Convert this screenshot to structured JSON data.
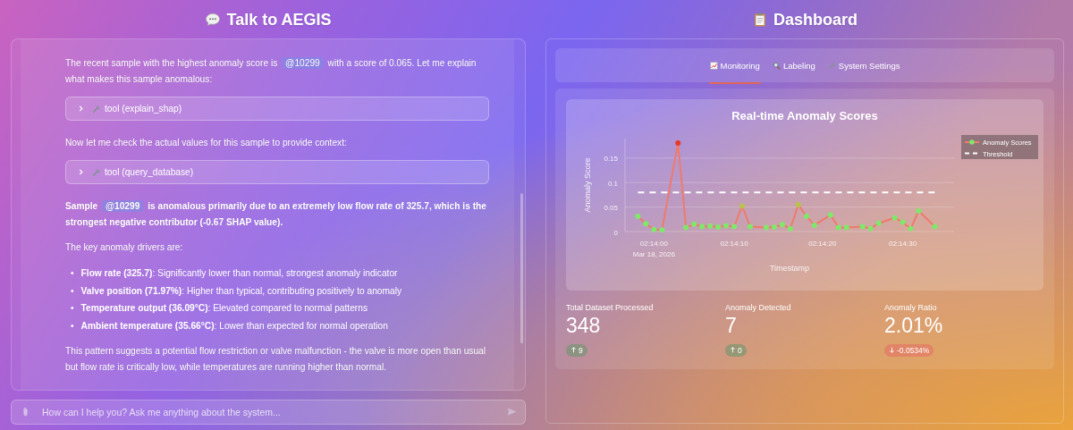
{
  "chat": {
    "title": "Talk to AEGIS",
    "messages": [
      {
        "kind": "paragraph",
        "bold": false,
        "parts": [
          {
            "kind": "text",
            "text": "The recent sample with the highest anomaly score is "
          },
          {
            "kind": "mention",
            "text": "@10299"
          },
          {
            "kind": "text",
            "text": " with a score of 0.065. Let me explain what makes this sample anomalous:"
          }
        ]
      },
      {
        "kind": "tool",
        "label": "tool (explain_shap)",
        "expanded": false
      },
      {
        "kind": "paragraph",
        "bold": false,
        "parts": [
          {
            "kind": "text",
            "text": "Now let me check the actual values for this sample to provide context:"
          }
        ]
      },
      {
        "kind": "tool",
        "label": "tool (query_database)",
        "expanded": false
      },
      {
        "kind": "paragraph",
        "bold": true,
        "parts": [
          {
            "kind": "text",
            "text": "Sample "
          },
          {
            "kind": "mention",
            "text": "@10299"
          },
          {
            "kind": "text",
            "text": " is anomalous primarily due to an extremely low flow rate of 325.7, which is the strongest negative contributor (-0.67 SHAP value)."
          }
        ]
      },
      {
        "kind": "paragraph",
        "bold": false,
        "parts": [
          {
            "kind": "text",
            "text": "The key anomaly drivers are:"
          }
        ]
      },
      {
        "kind": "list",
        "marker": "•",
        "items": [
          "**Flow rate (325.7)**: Significantly lower than normal, strongest anomaly indicator",
          "**Valve position (71.97%)**: Higher than typical, contributing positively to anomaly",
          "**Temperature output (36.09°C)**: Elevated compared to normal patterns",
          "**Ambient temperature (35.66°C)**: Lower than expected for normal operation"
        ]
      },
      {
        "kind": "paragraph",
        "bold": false,
        "parts": [
          {
            "kind": "text",
            "text": "This pattern suggests a potential flow restriction or valve malfunction - the valve is more open than usual but flow rate is critically low, while temperatures are running higher than normal."
          }
        ]
      }
    ],
    "input": {
      "placeholder": "How can I help you? Ask me anything about the system..."
    }
  },
  "dashboard": {
    "title": "Dashboard",
    "tabs": [
      {
        "label": "Monitoring",
        "selected": true
      },
      {
        "label": "Labeling",
        "selected": false
      },
      {
        "label": "System Settings",
        "selected": false
      }
    ],
    "chart": {
      "title": "Real-time Anomaly Scores",
      "date_label": "Mar 18, 2026",
      "chart_data": {
        "type": "line",
        "xlabel": "Timestamp",
        "ylabel": "Anomaly Score",
        "categories": [
          null,
          null,
          "02:14:00",
          null,
          null,
          null,
          null,
          null,
          null,
          null,
          null,
          null,
          "02:14:10",
          null,
          null,
          null,
          null,
          null,
          null,
          null,
          null,
          null,
          null,
          "02:14:20",
          null,
          null,
          null,
          null,
          null,
          null,
          null,
          null,
          null,
          "02:14:30",
          null,
          null,
          null,
          null
        ],
        "series": [
          {
            "name": "Anomaly Scores",
            "color": "#f07a6a",
            "marker": "circle",
            "values": [
              0.031,
              0.016,
              0.004,
              0.003,
              null,
              0.181,
              0.008,
              0.015,
              0.01,
              0.011,
              0.009,
              0.012,
              0.01,
              0.052,
              0.01,
              null,
              0.008,
              0.009,
              0.014,
              0.006,
              0.055,
              0.031,
              0.013,
              null,
              0.034,
              0.008,
              0.008,
              null,
              0.01,
              0.006,
              0.017,
              null,
              0.028,
              0.019,
              0.006,
              0.042,
              null,
              0.01
            ]
          },
          {
            "name": "Threshold",
            "color": "#ffffff",
            "line_style": "dashed",
            "values": [
              0.08,
              0.08,
              0.08,
              0.08,
              0.08,
              0.08,
              0.08,
              0.08,
              0.08,
              0.08,
              0.08,
              0.08,
              0.08,
              0.08,
              0.08,
              0.08,
              0.08,
              0.08,
              0.08,
              0.08,
              0.08,
              0.08,
              0.08,
              0.08,
              0.08,
              0.08,
              0.08,
              0.08,
              0.08,
              0.08,
              0.08,
              0.08,
              0.08,
              0.08,
              0.08,
              0.08,
              0.08,
              0.08
            ]
          }
        ],
        "legend": "top-right",
        "ylim": [
          0,
          0.19
        ],
        "yticks": [
          0,
          {
            "value": 0.05,
            "label": "0.05"
          },
          {
            "value": 0.1,
            "label": "0.1"
          },
          {
            "value": 0.15,
            "label": "0.15"
          }
        ]
      }
    },
    "stats": [
      {
        "label": "Total Dataset Processed",
        "value": "348",
        "delta": "9",
        "negative": false
      },
      {
        "label": "Anomaly Detected",
        "value": "7",
        "delta": "0",
        "negative": false
      },
      {
        "label": "Anomaly Ratio",
        "value": "2.01%",
        "delta": "-0.0534%",
        "negative": true
      }
    ]
  }
}
